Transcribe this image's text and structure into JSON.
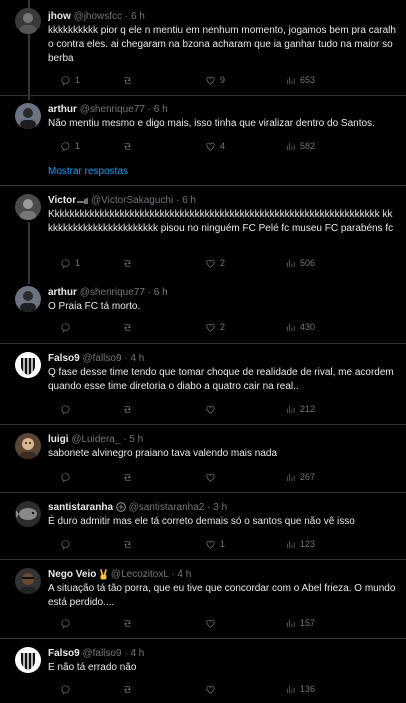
{
  "tweets": [
    {
      "name": "jhow",
      "handle": "@jhowsfcc",
      "time": "6 h",
      "text": "kkkkkkkkkk pior q ele n mentiu em nenhum momento, jogamos bem pra caralho contra eles. ai chegaram na bzona acharam que ia ganhar tudo na maior soberba",
      "replies": "1",
      "reposts": "",
      "likes": "9",
      "views": "653"
    },
    {
      "name": "arthur",
      "handle": "@shenrique77",
      "time": "6 h",
      "text": "Não mentiu mesmo e digo mais, isso tinha que viralizar dentro do Santos.",
      "replies": "1",
      "reposts": "",
      "likes": "4",
      "views": "582"
    },
    {
      "name": "Victor",
      "handle": "@VictorSakaguchi",
      "time": "6 h",
      "text": "Kkkkkkkkkkkkkkkkkkkkkkkkkkkkkkkkkkkkkkkkkkkkkkkkkkkkkkkkkkkkkkkkkk kkkkkkkkkkkkkkkkkkkkkkkk pisou no ninguém FC Pelé fc museu FC parabéns fc",
      "replies": "1",
      "reposts": "",
      "likes": "2",
      "views": "506"
    },
    {
      "name": "arthur",
      "handle": "@shenrique77",
      "time": "6 h",
      "text": "O Praia FC tá morto.",
      "replies": "",
      "reposts": "",
      "likes": "2",
      "views": "430"
    },
    {
      "name": "Falso9",
      "handle": "@fallso9",
      "time": "4 h",
      "text": "Q fase desse time tendo que tomar choque de realidade de rival, me acordem quando esse time diretoria o diabo a quatro cair na real..",
      "replies": "",
      "reposts": "",
      "likes": "",
      "views": "212"
    },
    {
      "name": "luigi",
      "handle": "@Luidera_",
      "time": "5 h",
      "text": "sabonete alvinegro praiano tava valendo mais nada",
      "replies": "",
      "reposts": "",
      "likes": "",
      "views": "267"
    },
    {
      "name": "santistaranha",
      "handle": "@santistaranha2",
      "time": "3 h",
      "text": "É duro admitir mas ele tá correto demais só o santos que não vê isso",
      "replies": "",
      "reposts": "",
      "likes": "1",
      "views": "123"
    },
    {
      "name": "Nego Veio",
      "handle": "@LecozitoxL",
      "time": "4 h",
      "text": "A situação tá tão porra, que eu tive que concordar com o Abel frieza. O mundo está perdido....",
      "replies": "",
      "reposts": "",
      "likes": "",
      "views": "157"
    },
    {
      "name": "Falso9",
      "handle": "@fallso9",
      "time": "4 h",
      "text": "E não tá errado não",
      "replies": "",
      "reposts": "",
      "likes": "",
      "views": "136"
    }
  ],
  "show_more_label": "Mostrar respostas",
  "dot": "·",
  "colors": {
    "background": "#000000",
    "text": "#e7e9ea",
    "muted": "#71767b",
    "link": "#1d9bf0",
    "divider": "#2f3336"
  },
  "icons": [
    "reply-icon",
    "repost-icon",
    "like-icon",
    "views-icon",
    "verified-icon",
    "smoke-icon",
    "victory-hand-icon"
  ]
}
